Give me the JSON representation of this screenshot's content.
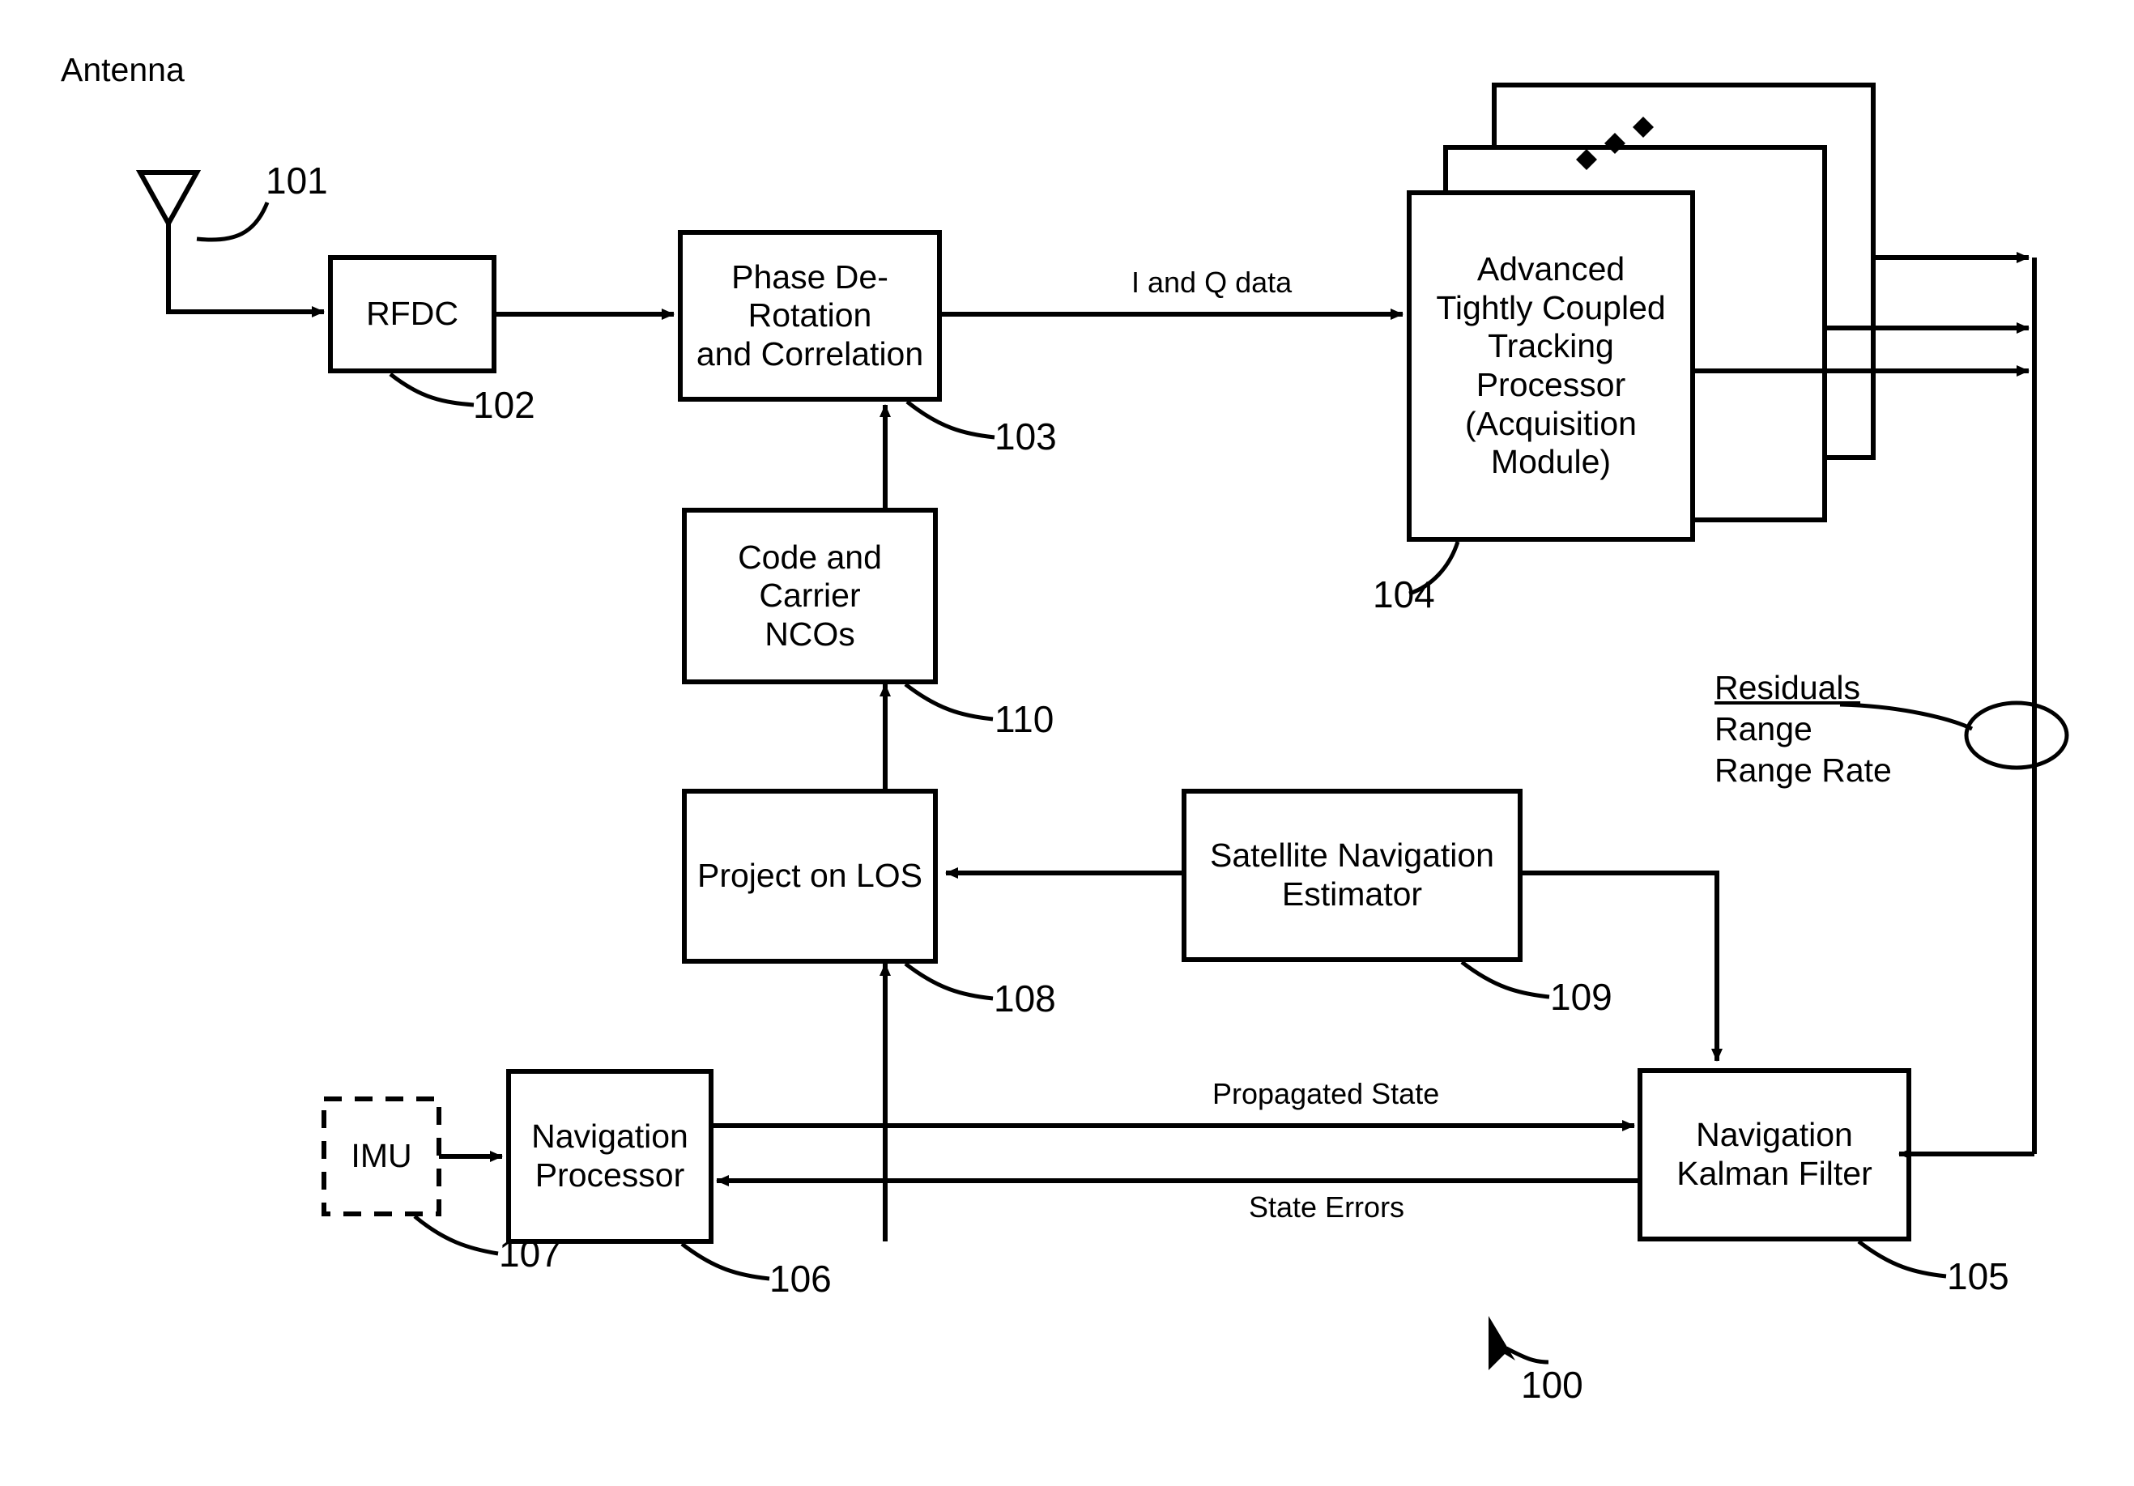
{
  "figure": {
    "title_ref": "100",
    "blocks": [
      {
        "id": "antenna",
        "label": "Antenna",
        "ref": "101"
      },
      {
        "id": "rfdc",
        "label": "RFDC",
        "ref": "102"
      },
      {
        "id": "phase",
        "label": "Phase De-Rotation\nand Correlation",
        "ref": "103"
      },
      {
        "id": "atctp",
        "label": "Advanced\nTightly Coupled\nTracking\nProcessor\n(Acquisition\nModule)",
        "ref": "104"
      },
      {
        "id": "nkf",
        "label": "Navigation\nKalman Filter",
        "ref": "105"
      },
      {
        "id": "navproc",
        "label": "Navigation\nProcessor",
        "ref": "106"
      },
      {
        "id": "imu",
        "label": "IMU",
        "ref": "107"
      },
      {
        "id": "los",
        "label": "Project on LOS",
        "ref": "108"
      },
      {
        "id": "satnav",
        "label": "Satellite Navigation\nEstimator",
        "ref": "109"
      },
      {
        "id": "ncos",
        "label": "Code and Carrier\nNCOs",
        "ref": "110"
      }
    ],
    "edge_labels": {
      "iq_data": "I and Q data",
      "propagated_state": "Propagated State",
      "state_errors": "State Errors"
    },
    "residuals": {
      "title": "Residuals",
      "items": [
        "Range",
        "Range Rate"
      ]
    },
    "colors": {
      "stroke": "#000000",
      "background": "#ffffff"
    }
  }
}
